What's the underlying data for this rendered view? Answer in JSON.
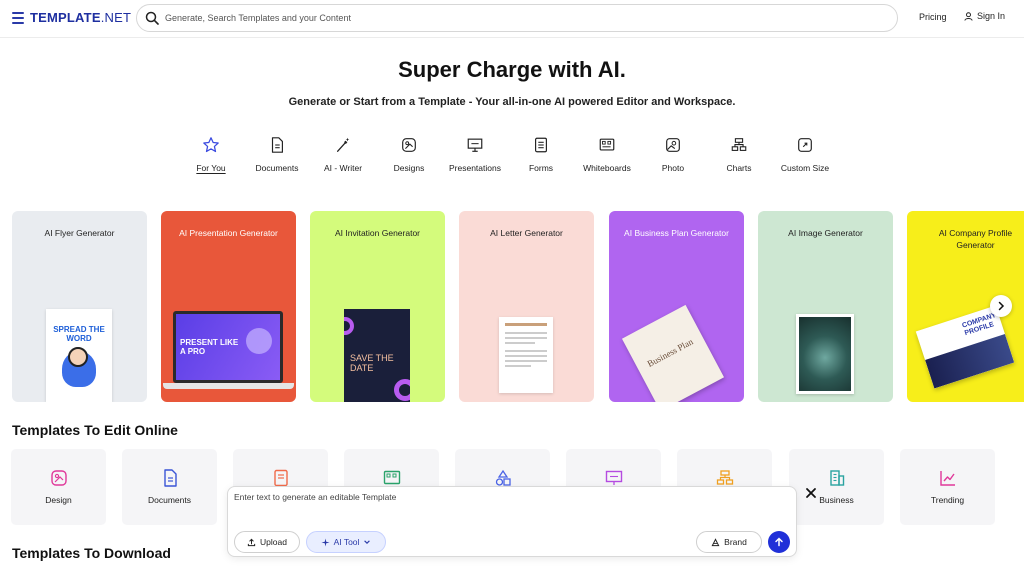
{
  "header": {
    "logo_main": "TEMPLATE",
    "logo_suffix": ".NET",
    "search_placeholder": "Generate, Search Templates and your Content",
    "pricing": "Pricing",
    "signin": "Sign In"
  },
  "hero": {
    "title": "Super Charge with AI.",
    "subtitle": "Generate or Start from a Template - Your all-in-one AI powered Editor and Workspace."
  },
  "tabs": [
    {
      "label": "For You",
      "icon": "star-icon",
      "active": true
    },
    {
      "label": "Documents",
      "icon": "document-icon"
    },
    {
      "label": "AI - Writer",
      "icon": "magic-pen-icon"
    },
    {
      "label": "Designs",
      "icon": "design-icon"
    },
    {
      "label": "Presentations",
      "icon": "presentation-icon"
    },
    {
      "label": "Forms",
      "icon": "form-icon"
    },
    {
      "label": "Whiteboards",
      "icon": "whiteboard-icon"
    },
    {
      "label": "Photo",
      "icon": "photo-icon"
    },
    {
      "label": "Charts",
      "icon": "chart-icon"
    },
    {
      "label": "Custom Size",
      "icon": "resize-icon"
    }
  ],
  "cards": [
    {
      "title": "AI Flyer Generator",
      "bg": "#e9ecf0",
      "fg": "#222222",
      "thumb_text": "SPREAD THE WORD"
    },
    {
      "title": "AI Presentation Generator",
      "bg": "#e8573a",
      "fg": "#ffffff",
      "thumb_text": "PRESENT LIKE A PRO"
    },
    {
      "title": "AI Invitation Generator",
      "bg": "#d4fb7c",
      "fg": "#222222",
      "thumb_text": "SAVE THE DATE"
    },
    {
      "title": "AI Letter Generator",
      "bg": "#fadbd6",
      "fg": "#222222",
      "thumb_text": ""
    },
    {
      "title": "AI Business Plan Generator",
      "bg": "#b065f0",
      "fg": "#ffffff",
      "thumb_text": "Business Plan"
    },
    {
      "title": "AI Image Generator",
      "bg": "#cde7d2",
      "fg": "#222222",
      "thumb_text": ""
    },
    {
      "title": "AI Company Profile Generator",
      "bg": "#f7ee1a",
      "fg": "#222222",
      "thumb_text": "COMPANY PROFILE"
    }
  ],
  "sections": {
    "edit_online": "Templates To Edit Online",
    "download": "Templates To Download"
  },
  "tiles": [
    {
      "label": "Design",
      "color": "#e0389a"
    },
    {
      "label": "Documents",
      "color": "#3a55d6"
    },
    {
      "label": "",
      "color": "#f06a4a"
    },
    {
      "label": "",
      "color": "#2aa36b"
    },
    {
      "label": "",
      "color": "#4a63e6"
    },
    {
      "label": "",
      "color": "#b54be0"
    },
    {
      "label": "",
      "color": "#f0a020"
    },
    {
      "label": "Business",
      "color": "#2aa3a0"
    },
    {
      "label": "Trending",
      "color": "#e0389a"
    }
  ],
  "prompt": {
    "placeholder": "Enter text to generate an editable Template",
    "upload": "Upload",
    "ai_tool": "AI Tool",
    "brand": "Brand"
  },
  "colors": {
    "brand": "#1e2fa0",
    "send": "#2030d8"
  }
}
